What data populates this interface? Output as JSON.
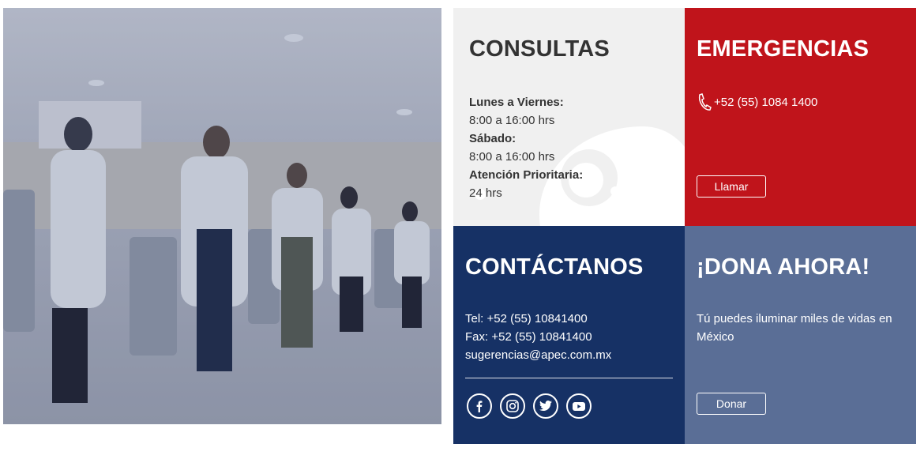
{
  "photo": {
    "alt_icon": "team-photo"
  },
  "consultas": {
    "title": "CONSULTAS",
    "weekday_label": "Lunes a Viernes:",
    "weekday_hours": "8:00 a 16:00 hrs",
    "saturday_label": "Sábado:",
    "saturday_hours": "8:00 a 16:00 hrs",
    "priority_label": "Atención Prioritaria:",
    "priority_hours": "24 hrs"
  },
  "emergencias": {
    "title": "EMERGENCIAS",
    "phone": "+52 (55) 1084 1400",
    "button": "Llamar"
  },
  "contactanos": {
    "title": "CONTÁCTANOS",
    "tel": "Tel: +52 (55) 10841400",
    "fax": "Fax: +52 (55) 10841400",
    "email": "sugerencias@apec.com.mx",
    "social": [
      "facebook-icon",
      "instagram-icon",
      "twitter-icon",
      "youtube-icon"
    ]
  },
  "dona": {
    "title": "¡DONA AHORA!",
    "text": "Tú puedes iluminar miles de vidas en México",
    "button": "Donar"
  },
  "colors": {
    "red": "#c0141b",
    "navy": "#163165",
    "slate": "#5a6e96",
    "light": "#f0f0f0"
  }
}
